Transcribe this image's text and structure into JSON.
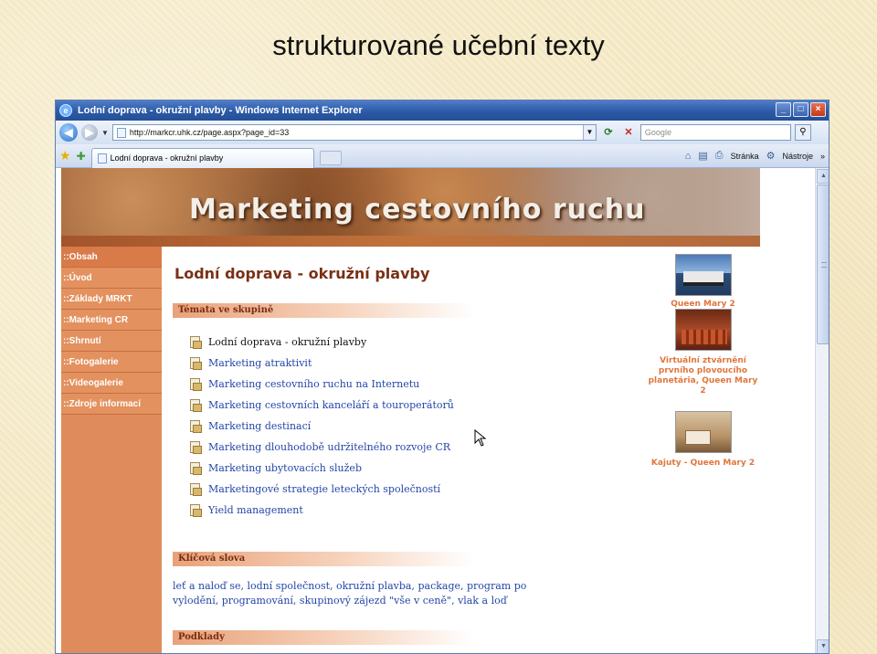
{
  "slide": {
    "title": "strukturované učební texty"
  },
  "browser": {
    "window_title": "Lodní doprava - okružní plavby - Windows Internet Explorer",
    "controls": {
      "minimize": "_",
      "maximize": "□",
      "close": "×"
    },
    "url": "http://markcr.uhk.cz/page.aspx?page_id=33",
    "search_placeholder": "Google",
    "tab_label": "Lodní doprava - okružní plavby",
    "cmd_page": "Stránka",
    "cmd_tools": "Nástroje",
    "cmd_more": "»"
  },
  "site": {
    "banner_title": "Marketing cestovního ruchu",
    "nav": [
      {
        "label": "::Obsah"
      },
      {
        "label": "::Úvod"
      },
      {
        "label": "::Základy MRKT"
      },
      {
        "label": "::Marketing CR"
      },
      {
        "label": "::Shrnutí"
      },
      {
        "label": "::Fotogalerie"
      },
      {
        "label": "::Videogalerie"
      },
      {
        "label": "::Zdroje informací"
      }
    ],
    "heading": "Lodní doprava - okružní plavby",
    "section_topics": "Témata ve skupině",
    "topics": [
      {
        "label": "Lodní doprava - okružní plavby",
        "current": true
      },
      {
        "label": "Marketing atraktivit",
        "current": false
      },
      {
        "label": "Marketing cestovního ruchu na Internetu",
        "current": false
      },
      {
        "label": "Marketing cestovních kanceláří a touroperátorů",
        "current": false
      },
      {
        "label": "Marketing destinací",
        "current": false
      },
      {
        "label": "Marketing dlouhodobě udržitelného rozvoje CR",
        "current": false
      },
      {
        "label": "Marketing ubytovacích služeb",
        "current": false
      },
      {
        "label": "Marketingové strategie leteckých společností",
        "current": false
      },
      {
        "label": "Yield management",
        "current": false
      }
    ],
    "section_keywords": "Klíčová slova",
    "keywords": "leť a naloď se, lodní společnost, okružní plavba, package, program po vylodění, programování, skupinový zájezd \"vše v ceně\", vlak a loď",
    "section_next": "Podklady",
    "thumbnails": [
      {
        "caption": "Queen Mary 2",
        "icon": "ship-photo"
      },
      {
        "caption": "Virtuální ztvárnění prvního plovoucího planetária, Queen Mary 2",
        "icon": "theater-photo"
      },
      {
        "caption": "Kajuty - Queen Mary 2",
        "icon": "cabin-photo"
      }
    ]
  },
  "colors": {
    "sidebar": "#e08b5b",
    "heading": "#7a3015",
    "link": "#2346a8",
    "caption": "#e0763c"
  }
}
